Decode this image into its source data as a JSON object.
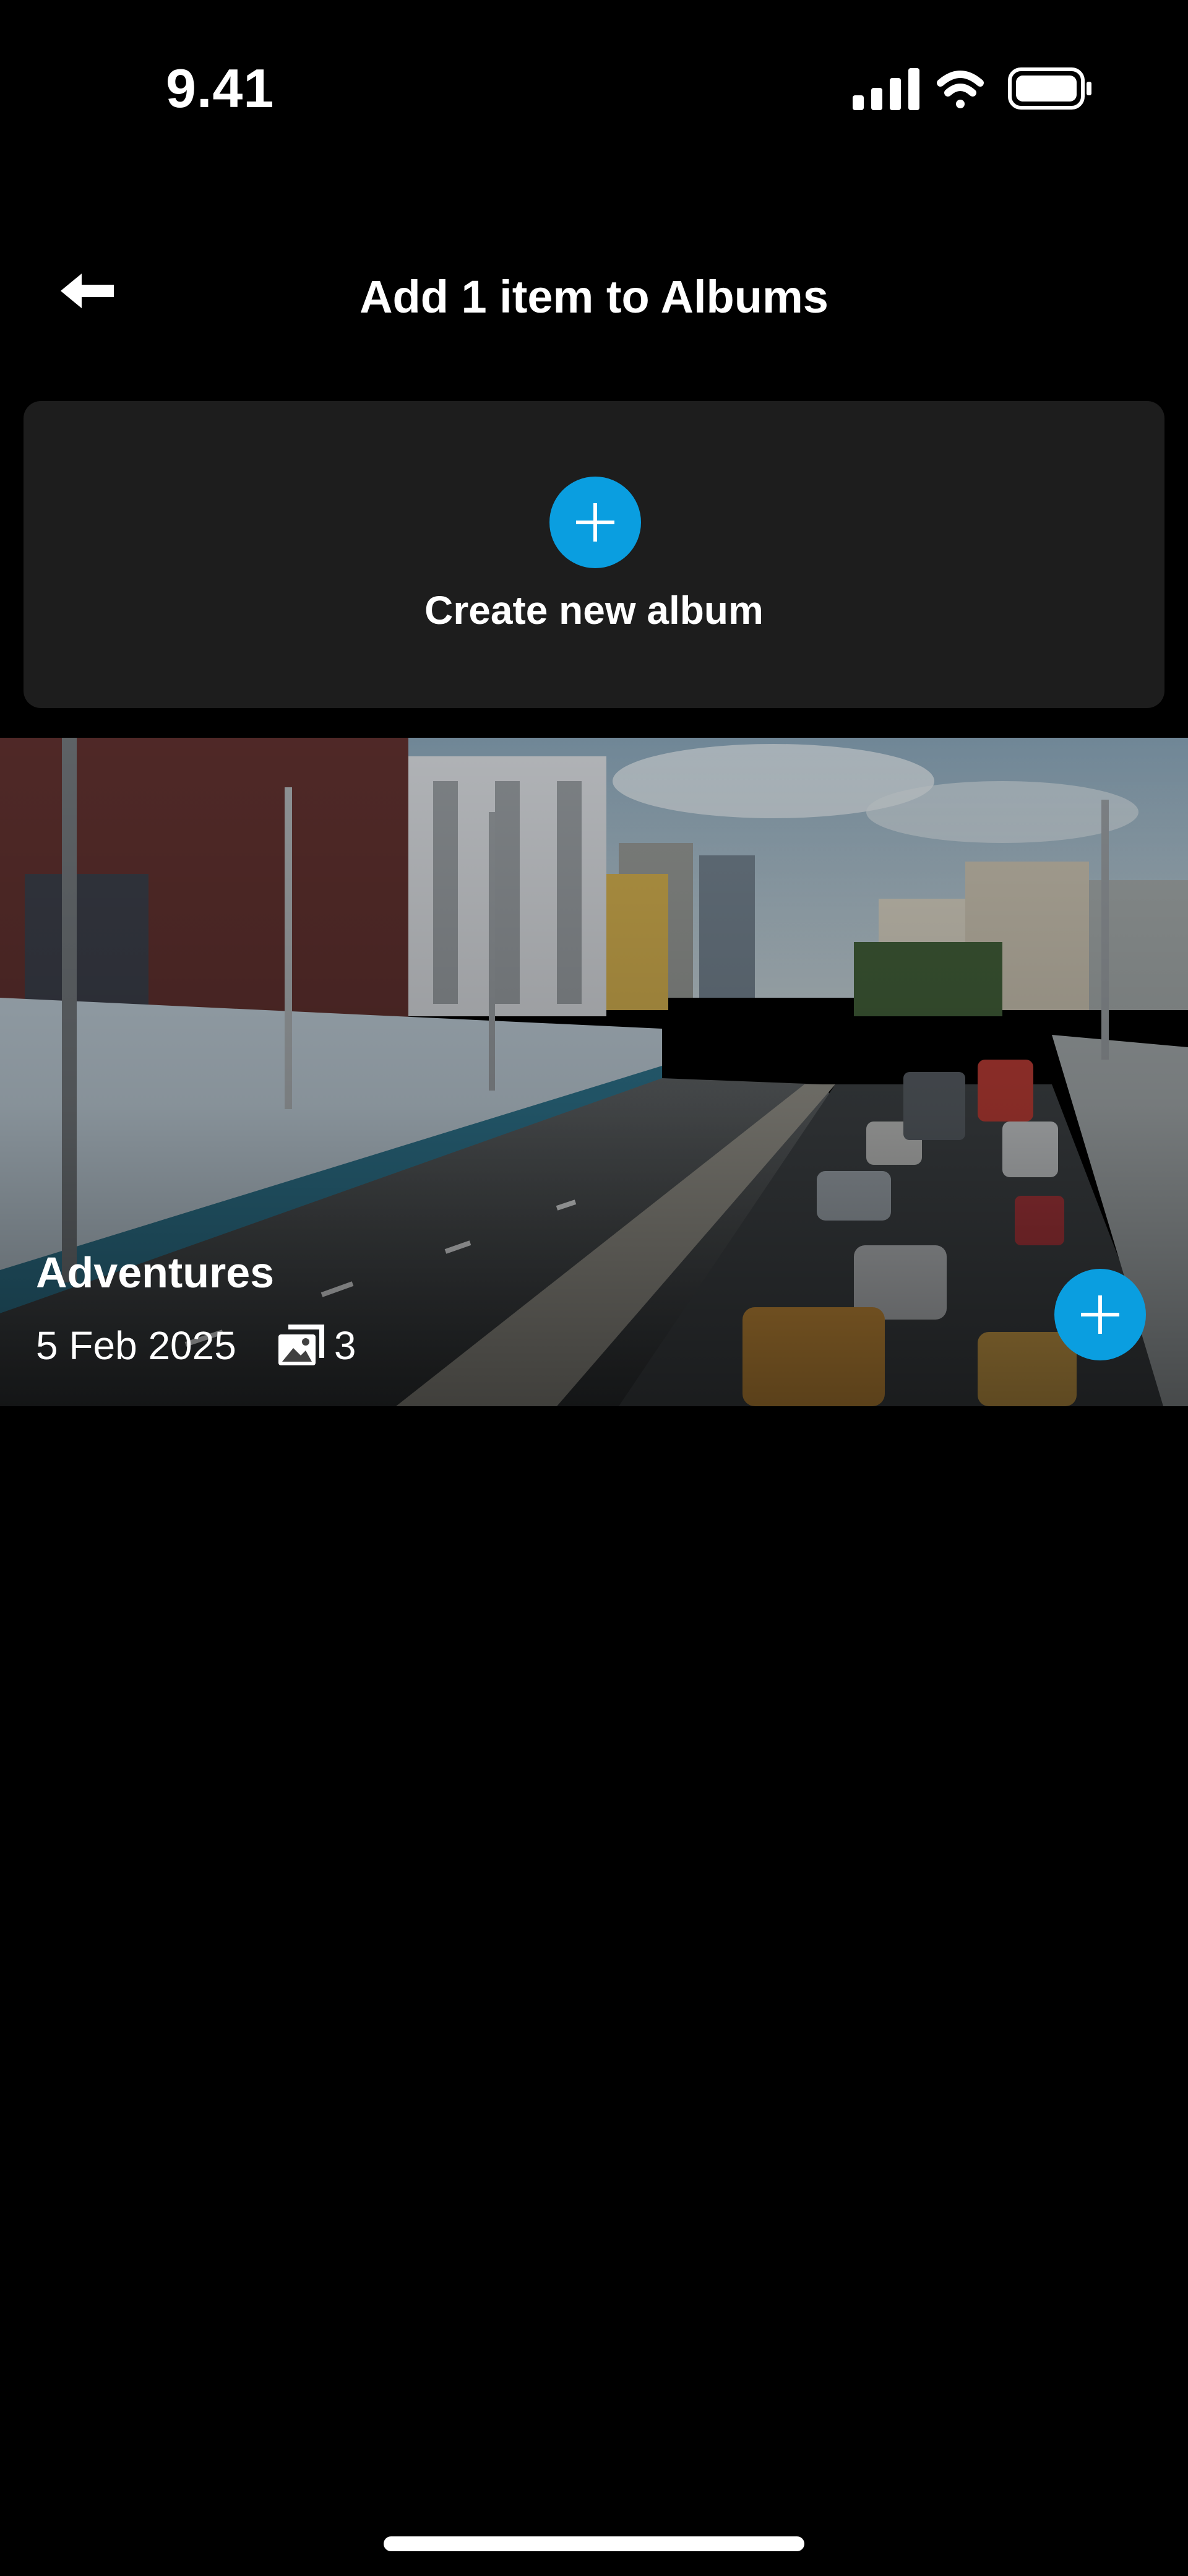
{
  "status_bar": {
    "time": "9.41",
    "icons": [
      "signal-icon",
      "wifi-icon",
      "battery-icon"
    ]
  },
  "header": {
    "back_icon": "arrow-left-icon",
    "title": "Add 1 item to Albums"
  },
  "create_album": {
    "icon": "plus-icon",
    "label": "Create new album"
  },
  "albums": [
    {
      "name": "Adventures",
      "date": "5 Feb 2025",
      "count": "3",
      "count_icon": "photo-stack-icon",
      "add_icon": "plus-icon"
    }
  ],
  "colors": {
    "accent": "#0a9ee0",
    "card": "#1d1d1d",
    "background": "#000000"
  }
}
